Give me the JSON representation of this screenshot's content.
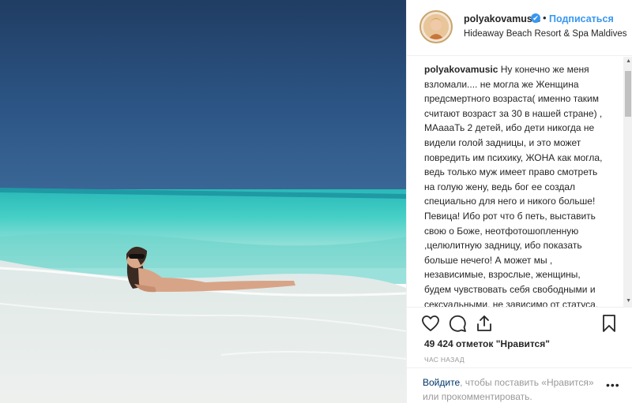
{
  "post": {
    "username": "polyakovamusic",
    "verified_mark": "✔",
    "separator": "•",
    "follow_label": "Подписаться",
    "location": "Hideaway Beach Resort & Spa Maldives"
  },
  "caption": {
    "username": "polyakovamusic",
    "text": " Ну конечно же меня\nвзломали.... не могла же Женщина\nпредсмертного возраста( именно таким\nсчитают возраст за 30 в нашей стране) ,\nМАаааТь 2 детей, ибо дети никогда не\nвидели голой задницы, и это может\nповредить им психику, ЖОНА как могла,\nведь только муж имеет право смотреть\nна голую жену, ведь бог ее создал\nспециально для него и никого больше!\nПевица! Ибо рот что б петь, выставить\nсвою о Боже, неотфотошопленную\n,целюлитную задницу, ибо показать\nбольше нечего! А может мы ,\nнезависимые, взрослые, женщины,\nбудем чувствовать себя свободными и\nсексуальными, не зависимо от статуса,\nвозраста и наличия детей, и засунем эти\nпредрассудки туда , куда я показала в\nпрошлых постах!!!! Поддержим челендж"
  },
  "scrollbar": {
    "up_arrow": "▲",
    "down_arrow": "▼"
  },
  "actions": {
    "like_icon": "heart-icon",
    "comment_icon": "comment-icon",
    "share_icon": "share-icon",
    "save_icon": "bookmark-icon"
  },
  "likes_text": "49 424 отметок \"Нравится\"",
  "time_text": "час назад",
  "login": {
    "link_text": "Войдите",
    "middle_text": ", чтобы поставить «Нравится»",
    "or_text": "или ",
    "link2_text": "прокомментировать",
    "end_text": ".",
    "more_label": "•••"
  },
  "colors": {
    "accent": "#3897f0",
    "text": "#262626",
    "muted": "#999999",
    "sky_top": "#2a4f7d",
    "sea": "#3fc9c2",
    "sand": "#e7ecec"
  }
}
